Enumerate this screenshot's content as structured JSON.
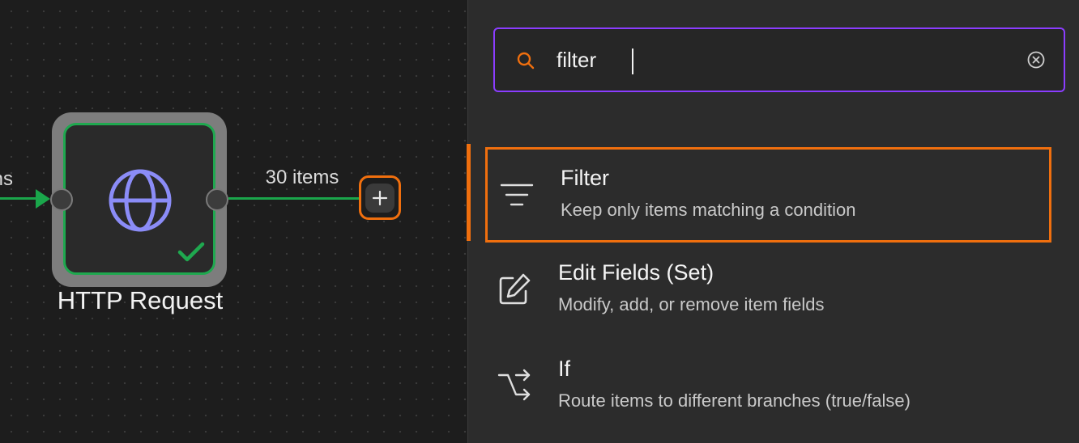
{
  "canvas": {
    "incoming_edge_label": "ns",
    "node": {
      "name": "HTTP Request",
      "icon": "globe-icon",
      "status": "success",
      "status_icon": "checkmark-icon",
      "status_color": "#1fa84f"
    },
    "outgoing_edge_label": "30 items",
    "add_node_icon": "plus-icon"
  },
  "search": {
    "query": "filter",
    "icon": "search-icon",
    "clear_icon": "clear-circle-icon",
    "border_color": "#8b3dff"
  },
  "results": [
    {
      "title": "Filter",
      "description": "Keep only items matching a condition",
      "icon": "filter-lines-icon",
      "highlighted": true
    },
    {
      "title": "Edit Fields (Set)",
      "description": "Modify, add, or remove item fields",
      "icon": "edit-square-icon",
      "highlighted": false
    },
    {
      "title": "If",
      "description": "Route items to different branches (true/false)",
      "icon": "branch-arrows-icon",
      "highlighted": false
    }
  ],
  "colors": {
    "accent_orange": "#f06f0e",
    "success_green": "#1aa64b",
    "node_icon_purple": "#8b8cf7"
  }
}
